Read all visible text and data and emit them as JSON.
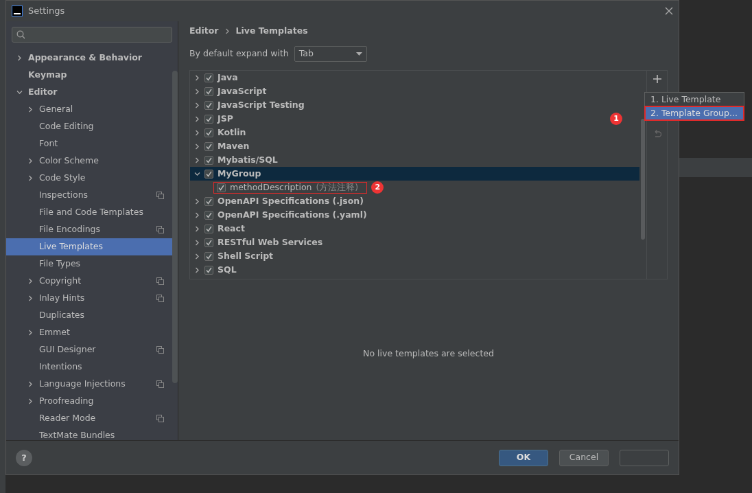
{
  "window": {
    "title": "Settings"
  },
  "sidebar": {
    "items": [
      {
        "label": "Appearance & Behavior",
        "expanded": false,
        "selected": false
      },
      {
        "label": "Keymap",
        "selected": false
      },
      {
        "label": "Editor",
        "expanded": true,
        "selected": false,
        "children": [
          {
            "label": "General",
            "expanded": false,
            "selected": false
          },
          {
            "label": "Code Editing",
            "selected": false
          },
          {
            "label": "Font",
            "selected": false
          },
          {
            "label": "Color Scheme",
            "expanded": false,
            "selected": false
          },
          {
            "label": "Code Style",
            "expanded": false,
            "selected": false
          },
          {
            "label": "Inspections",
            "selected": false,
            "project_level": true
          },
          {
            "label": "File and Code Templates",
            "selected": false
          },
          {
            "label": "File Encodings",
            "selected": false,
            "project_level": true
          },
          {
            "label": "Live Templates",
            "selected": true
          },
          {
            "label": "File Types",
            "selected": false
          },
          {
            "label": "Copyright",
            "expanded": false,
            "selected": false,
            "project_level": true
          },
          {
            "label": "Inlay Hints",
            "expanded": false,
            "selected": false,
            "project_level": true
          },
          {
            "label": "Duplicates",
            "selected": false
          },
          {
            "label": "Emmet",
            "expanded": false,
            "selected": false
          },
          {
            "label": "GUI Designer",
            "selected": false,
            "project_level": true
          },
          {
            "label": "Intentions",
            "selected": false
          },
          {
            "label": "Language Injections",
            "expanded": false,
            "selected": false,
            "project_level": true
          },
          {
            "label": "Proofreading",
            "expanded": false,
            "selected": false
          },
          {
            "label": "Reader Mode",
            "selected": false,
            "project_level": true
          },
          {
            "label": "TextMate Bundles",
            "selected": false
          }
        ]
      }
    ]
  },
  "breadcrumb": [
    "Editor",
    "Live Templates"
  ],
  "expand_with": {
    "label": "By default expand with",
    "value": "Tab"
  },
  "template_groups": [
    {
      "label": "Java",
      "checked": true,
      "expanded": false,
      "selected": false
    },
    {
      "label": "JavaScript",
      "checked": true,
      "expanded": false,
      "selected": false
    },
    {
      "label": "JavaScript Testing",
      "checked": true,
      "expanded": false,
      "selected": false
    },
    {
      "label": "JSP",
      "checked": true,
      "expanded": false,
      "selected": false
    },
    {
      "label": "Kotlin",
      "checked": true,
      "expanded": false,
      "selected": false
    },
    {
      "label": "Maven",
      "checked": true,
      "expanded": false,
      "selected": false
    },
    {
      "label": "Mybatis/SQL",
      "checked": true,
      "expanded": false,
      "selected": false
    },
    {
      "label": "MyGroup",
      "checked": true,
      "expanded": true,
      "selected": true,
      "children": [
        {
          "label": "methodDescription",
          "description": "(方法注释)",
          "checked": true,
          "selected": false,
          "annotation": "2"
        }
      ]
    },
    {
      "label": "OpenAPI Specifications (.json)",
      "checked": true,
      "expanded": false,
      "selected": false
    },
    {
      "label": "OpenAPI Specifications (.yaml)",
      "checked": true,
      "expanded": false,
      "selected": false
    },
    {
      "label": "React",
      "checked": true,
      "expanded": false,
      "selected": false
    },
    {
      "label": "RESTful Web Services",
      "checked": true,
      "expanded": false,
      "selected": false
    },
    {
      "label": "Shell Script",
      "checked": true,
      "expanded": false,
      "selected": false
    },
    {
      "label": "SQL",
      "checked": true,
      "expanded": false,
      "selected": false
    }
  ],
  "add_menu": {
    "items": [
      {
        "label": "1. Live Template",
        "selected": false
      },
      {
        "label": "2. Template Group...",
        "selected": true
      }
    ],
    "annotation": "1"
  },
  "empty_message": "No live templates are selected",
  "buttons": [
    {
      "label": "OK",
      "kind": "primary"
    },
    {
      "label": "Cancel",
      "kind": "secondary"
    },
    {
      "kind": "disabled"
    }
  ],
  "help_button": "?"
}
